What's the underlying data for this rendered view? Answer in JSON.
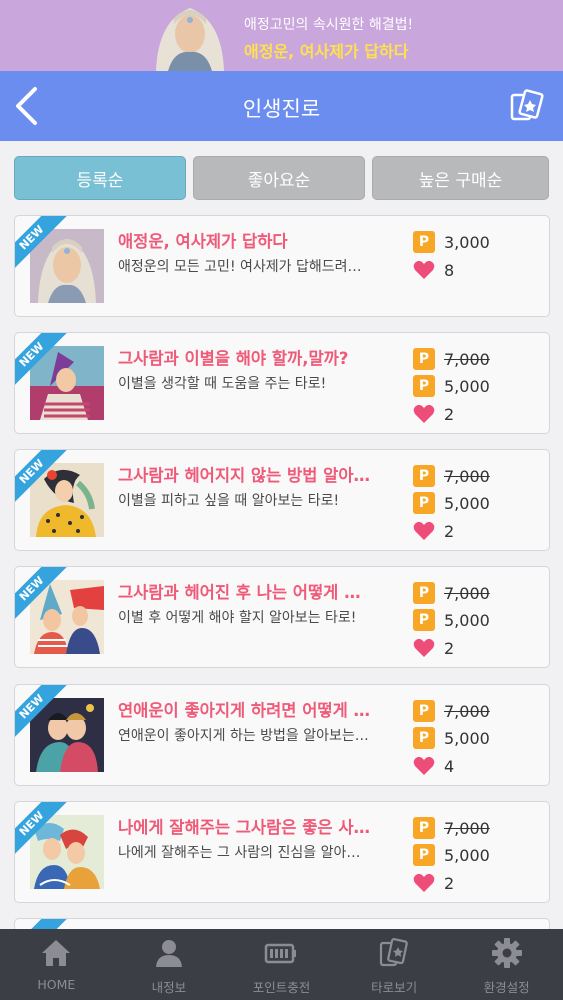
{
  "banner": {
    "line1": "애정고민의 속시원한 해결법!",
    "line2": "애정운, 여사제가 답하다"
  },
  "header": {
    "title": "인생진로",
    "back_icon": "chevron-left-icon",
    "cards_icon": "tarot-cards-icon"
  },
  "tabs": [
    {
      "label": "등록순",
      "active": true
    },
    {
      "label": "좋아요순",
      "active": false
    },
    {
      "label": "높은 구매순",
      "active": false
    }
  ],
  "colors": {
    "header": "#6c8df0",
    "title_pink": "#ef5a78",
    "point_orange": "#f7a626",
    "new_blue": "#35a4de",
    "tab_active": "#79c0d4"
  },
  "items": [
    {
      "badge": "NEW",
      "title": "애정운, 여사제가 답하다",
      "desc": "애정운의 모든 고민! 여사제가 답해드려요~",
      "original_price": "",
      "price": "3,000",
      "likes": "8"
    },
    {
      "badge": "NEW",
      "title": "그사람과 이별을 해야 할까,말까?",
      "desc": "이별을 생각할 때 도움을 주는 타로!",
      "original_price": "7,000",
      "price": "5,000",
      "likes": "2"
    },
    {
      "badge": "NEW",
      "title": "그사람과 헤어지지 않는 방법 알아…",
      "desc": "이별을 피하고 싶을 때 알아보는 타로!",
      "original_price": "7,000",
      "price": "5,000",
      "likes": "2"
    },
    {
      "badge": "NEW",
      "title": "그사람과 헤어진 후 나는 어떻게 해…",
      "desc": "이별 후 어떻게 해야 할지 알아보는 타로!",
      "original_price": "7,000",
      "price": "5,000",
      "likes": "2"
    },
    {
      "badge": "NEW",
      "title": "연애운이 좋아지게 하려면 어떻게 …",
      "desc": "연애운이 좋아지게 하는 방법을 알아보는 …",
      "original_price": "7,000",
      "price": "5,000",
      "likes": "4"
    },
    {
      "badge": "NEW",
      "title": "나에게 잘해주는 그사람은 좋은 사…",
      "desc": "나에게 잘해주는 그 사람의 진심을 알아보…",
      "original_price": "7,000",
      "price": "5,000",
      "likes": "2"
    }
  ],
  "point_symbol": "P",
  "nav": [
    {
      "label": "HOME",
      "icon": "home-icon"
    },
    {
      "label": "내정보",
      "icon": "user-icon"
    },
    {
      "label": "포인트충전",
      "icon": "battery-icon"
    },
    {
      "label": "타로보기",
      "icon": "tarot-cards-icon"
    },
    {
      "label": "환경설정",
      "icon": "gear-icon"
    }
  ]
}
